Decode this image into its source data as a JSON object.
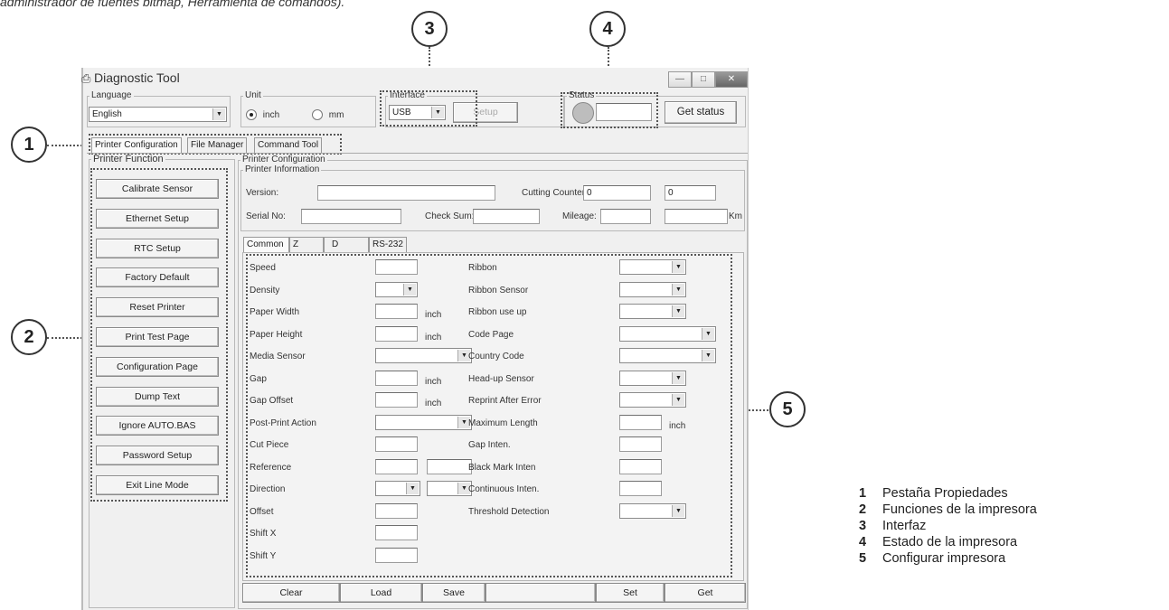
{
  "caption": "administrador de fuentes bitmap, Herramienta de comandos).",
  "window": {
    "title": "Diagnostic Tool",
    "language": {
      "label": "Language",
      "value": "English"
    },
    "unit": {
      "label": "Unit",
      "inch": "inch",
      "mm": "mm",
      "selected": "inch"
    },
    "interface": {
      "label": "Interface",
      "value": "USB",
      "setup_label": "Setup"
    },
    "status": {
      "label": "Status",
      "get_status_label": "Get status"
    },
    "tabs": [
      "Printer Configuration",
      "File Manager",
      "Command Tool"
    ],
    "printer_function": {
      "label": "Printer Function",
      "buttons": [
        "Calibrate Sensor",
        "Ethernet Setup",
        "RTC Setup",
        "Factory Default",
        "Reset Printer",
        "Print Test Page",
        "Configuration Page",
        "Dump Text",
        "Ignore AUTO.BAS",
        "Password Setup",
        "Exit Line Mode"
      ]
    },
    "printer_configuration": {
      "label": "Printer Configuration",
      "info": {
        "label": "Printer Information",
        "version": "Version:",
        "cutting_counter": "Cutting Counter:",
        "cutting_value_1": "0",
        "cutting_value_2": "0",
        "serial_no": "Serial No:",
        "check_sum": "Check Sum:",
        "mileage": "Mileage:",
        "km": "Km"
      },
      "sub_tabs": [
        "Common",
        "Z",
        "D",
        "RS-232"
      ],
      "left_fields": {
        "speed": "Speed",
        "density": "Density",
        "paper_width": "Paper Width",
        "paper_height": "Paper Height",
        "media_sensor": "Media Sensor",
        "gap": "Gap",
        "gap_offset": "Gap Offset",
        "post_print_action": "Post-Print Action",
        "cut_piece": "Cut Piece",
        "reference": "Reference",
        "direction": "Direction",
        "offset": "Offset",
        "shift_x": "Shift X",
        "shift_y": "Shift Y"
      },
      "right_fields": {
        "ribbon": "Ribbon",
        "ribbon_sensor": "Ribbon Sensor",
        "ribbon_use_up": "Ribbon use up",
        "code_page": "Code Page",
        "country_code": "Country Code",
        "head_up_sensor": "Head-up Sensor",
        "reprint_after_error": "Reprint After Error",
        "maximum_length": "Maximum Length",
        "gap_inten": "Gap Inten.",
        "black_mark_inten": "Black Mark Inten",
        "continuous_inten": "Continuous Inten.",
        "threshold_detection": "Threshold Detection"
      },
      "unit_inch": "inch",
      "bottom_buttons": [
        "Clear",
        "Load",
        "Save",
        "Set",
        "Get"
      ]
    }
  },
  "callouts": [
    "1",
    "2",
    "3",
    "4",
    "5"
  ],
  "legend": [
    {
      "num": "1",
      "text": "Pestaña Propiedades"
    },
    {
      "num": "2",
      "text": "Funciones de la impresora"
    },
    {
      "num": "3",
      "text": "Interfaz"
    },
    {
      "num": "4",
      "text": "Estado de la impresora"
    },
    {
      "num": "5",
      "text": "Configurar impresora"
    }
  ]
}
